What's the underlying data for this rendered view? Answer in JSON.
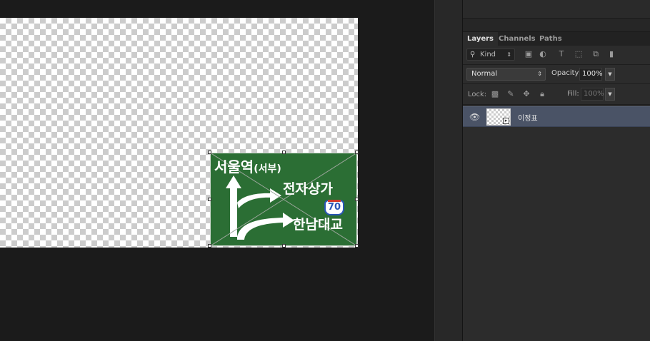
{
  "canvas": {
    "sign": {
      "top_left_text": "서울역",
      "top_left_paren": "(서부)",
      "right_text": "전자상가",
      "bottom_text": "한남대교",
      "route_number": "70",
      "sign_color": "#2b6e34"
    }
  },
  "layers_panel": {
    "tabs": [
      "Layers",
      "Channels",
      "Paths"
    ],
    "active_tab": "Layers",
    "filter": {
      "label": "Kind",
      "icons": [
        "image-icon",
        "adjustment-icon",
        "type-icon",
        "shape-icon",
        "smart-object-icon",
        "filter-toggle"
      ]
    },
    "blend_mode": "Normal",
    "opacity_label": "Opacity:",
    "opacity_value": "100%",
    "lock_label": "Lock:",
    "lock_icons": [
      "lock-transparent-icon",
      "lock-paint-icon",
      "lock-move-icon",
      "lock-all-icon"
    ],
    "fill_label": "Fill:",
    "fill_value": "100%",
    "layers": [
      {
        "name": "이정표",
        "visible": true,
        "selected": true
      }
    ],
    "selection_color": "#4a5366"
  }
}
